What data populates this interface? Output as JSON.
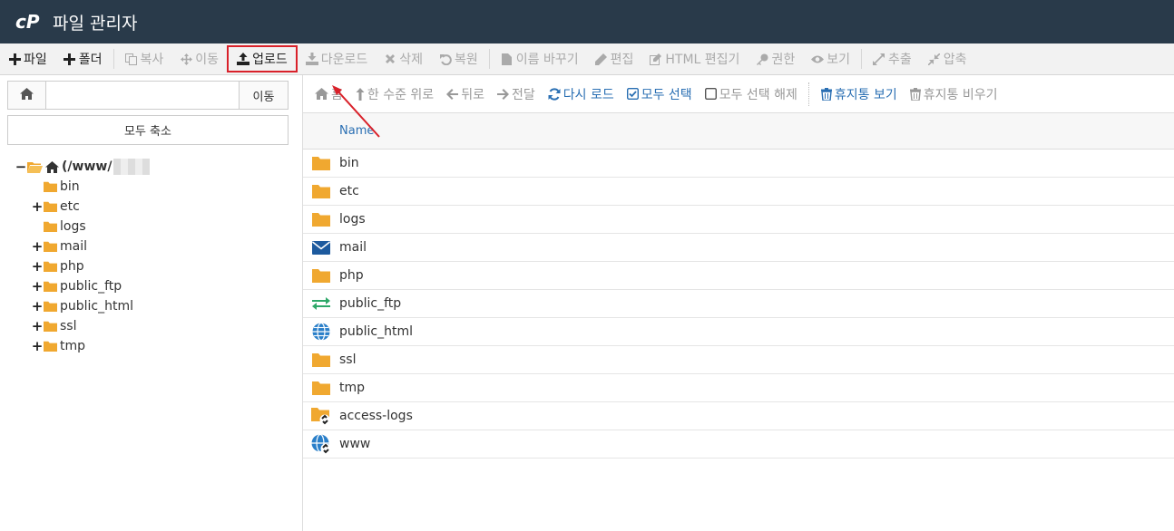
{
  "app": {
    "title": "파일 관리자"
  },
  "toolbar": [
    {
      "label": "파일",
      "icon": "plus-icon",
      "enabled": true
    },
    {
      "label": "폴더",
      "icon": "plus-icon",
      "enabled": true
    },
    {
      "label": "복사",
      "icon": "copy-icon",
      "enabled": false
    },
    {
      "label": "이동",
      "icon": "move-icon",
      "enabled": false
    },
    {
      "label": "업로드",
      "icon": "upload-icon",
      "enabled": true,
      "highlight": true
    },
    {
      "label": "다운로드",
      "icon": "download-icon",
      "enabled": false
    },
    {
      "label": "삭제",
      "icon": "x-icon",
      "enabled": false
    },
    {
      "label": "복원",
      "icon": "undo-icon",
      "enabled": false
    },
    {
      "label": "이름 바꾸기",
      "icon": "file-icon",
      "enabled": false
    },
    {
      "label": "편집",
      "icon": "pencil-icon",
      "enabled": false
    },
    {
      "label": "HTML 편집기",
      "icon": "edit-square-icon",
      "enabled": false
    },
    {
      "label": "권한",
      "icon": "key-icon",
      "enabled": false
    },
    {
      "label": "보기",
      "icon": "eye-icon",
      "enabled": false
    },
    {
      "label": "추출",
      "icon": "expand-icon",
      "enabled": false
    },
    {
      "label": "압축",
      "icon": "compress-icon",
      "enabled": false
    }
  ],
  "left": {
    "path_value": "",
    "go_label": "이동",
    "collapse_label": "모두 축소",
    "root_label": "(/www/",
    "tree": [
      {
        "name": "bin",
        "expandable": false
      },
      {
        "name": "etc",
        "expandable": true
      },
      {
        "name": "logs",
        "expandable": false
      },
      {
        "name": "mail",
        "expandable": true
      },
      {
        "name": "php",
        "expandable": true
      },
      {
        "name": "public_ftp",
        "expandable": true
      },
      {
        "name": "public_html",
        "expandable": true
      },
      {
        "name": "ssl",
        "expandable": true
      },
      {
        "name": "tmp",
        "expandable": true
      }
    ]
  },
  "right_toolbar": [
    {
      "label": "홈",
      "icon": "home-icon",
      "enabled": false
    },
    {
      "label": "한 수준 위로",
      "icon": "level-up-icon",
      "enabled": false
    },
    {
      "label": "뒤로",
      "icon": "arrow-left-icon",
      "enabled": false
    },
    {
      "label": "전달",
      "icon": "arrow-right-icon",
      "enabled": false
    },
    {
      "label": "다시 로드",
      "icon": "refresh-icon",
      "enabled": true
    },
    {
      "label": "모두 선택",
      "icon": "checked-box-icon",
      "enabled": true
    },
    {
      "label": "모두 선택 해제",
      "icon": "empty-box-icon",
      "enabled": false
    },
    {
      "label": "휴지통 보기",
      "icon": "trash-icon",
      "enabled": true,
      "sep_before": true
    },
    {
      "label": "휴지통 비우기",
      "icon": "trash-icon",
      "enabled": false
    }
  ],
  "table": {
    "header_name": "Name",
    "rows": [
      {
        "name": "bin",
        "icon": "folder"
      },
      {
        "name": "etc",
        "icon": "folder"
      },
      {
        "name": "logs",
        "icon": "folder"
      },
      {
        "name": "mail",
        "icon": "mail"
      },
      {
        "name": "php",
        "icon": "folder"
      },
      {
        "name": "public_ftp",
        "icon": "ftp"
      },
      {
        "name": "public_html",
        "icon": "globe"
      },
      {
        "name": "ssl",
        "icon": "folder"
      },
      {
        "name": "tmp",
        "icon": "folder"
      },
      {
        "name": "access-logs",
        "icon": "folder-link"
      },
      {
        "name": "www",
        "icon": "globe-link"
      }
    ]
  },
  "colors": {
    "header_bg": "#293a4a",
    "folder": "#f0a830",
    "link_blue": "#2a6fb3",
    "highlight_red": "#d9212a"
  }
}
